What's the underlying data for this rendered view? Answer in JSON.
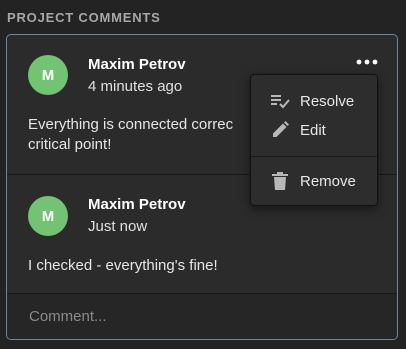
{
  "section": {
    "title": "PROJECT COMMENTS"
  },
  "comments": [
    {
      "avatar_initial": "M",
      "author": "Maxim Petrov",
      "time": "4 minutes ago",
      "text": "Everything is connected correc… critical point!",
      "text_line1": "Everything is connected correc",
      "text_line2": "critical point!"
    },
    {
      "avatar_initial": "M",
      "author": "Maxim Petrov",
      "time": "Just now",
      "text": "I checked - everything's fine!"
    }
  ],
  "menu": {
    "items": [
      {
        "label": "Resolve",
        "icon": "resolve-icon"
      },
      {
        "label": "Edit",
        "icon": "pencil-icon"
      },
      {
        "label": "Remove",
        "icon": "trash-icon"
      }
    ]
  },
  "input": {
    "placeholder": "Comment...",
    "value": ""
  },
  "colors": {
    "avatar": "#72c472",
    "panel_border": "#6a87a6",
    "background": "#232323"
  }
}
